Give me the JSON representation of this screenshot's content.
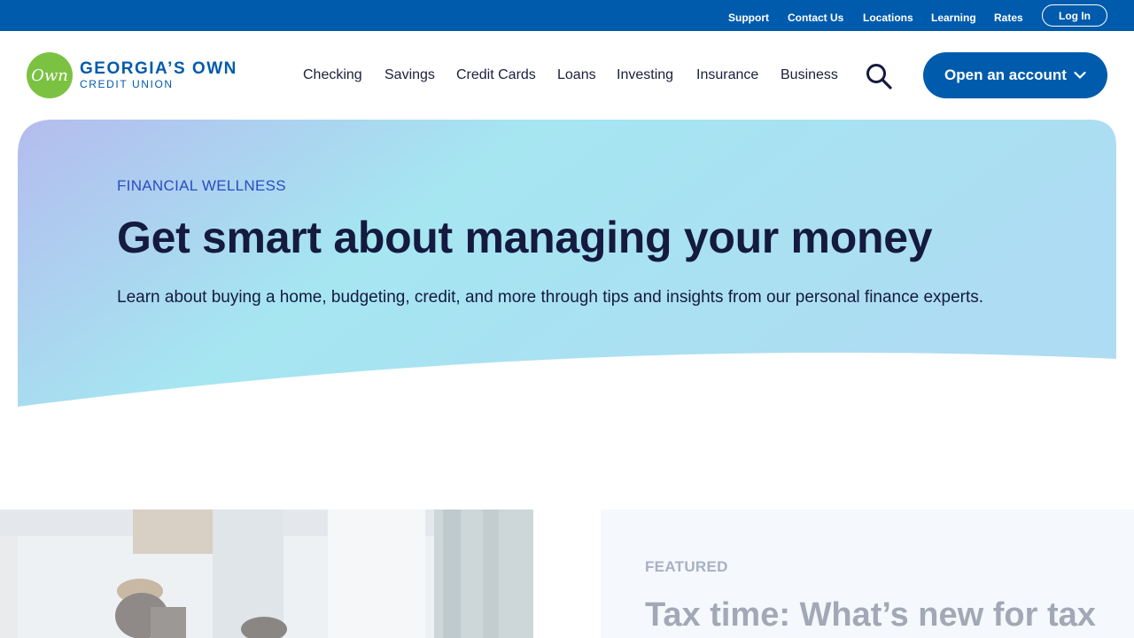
{
  "utility_nav": {
    "links": [
      "Support",
      "Contact Us",
      "Locations",
      "Learning",
      "Rates"
    ],
    "login_label": "Log In"
  },
  "logo": {
    "mark": "Own",
    "line1": "GEORGIA’S OWN",
    "line2": "CREDIT UNION"
  },
  "main_nav": {
    "items": [
      "Checking",
      "Savings",
      "Credit Cards",
      "Loans",
      "Investing",
      "Insurance",
      "Business"
    ],
    "search_icon": "search-icon",
    "open_account_label": "Open an account",
    "open_account_icon": "chevron-down-icon"
  },
  "hero": {
    "eyebrow": "FINANCIAL WELLNESS",
    "title": "Get smart about managing your money",
    "description": "Learn about buying a home, budgeting, credit, and more through tips and insights from our personal finance experts."
  },
  "featured": {
    "label": "FEATURED",
    "title": "Tax time: What’s new for tax"
  },
  "colors": {
    "brand_blue": "#005bac",
    "logo_green": "#7cc242",
    "hero_gradient_start": "#b4bcee",
    "hero_gradient_mid": "#a5e6f1",
    "heading_navy": "#151a3f"
  }
}
